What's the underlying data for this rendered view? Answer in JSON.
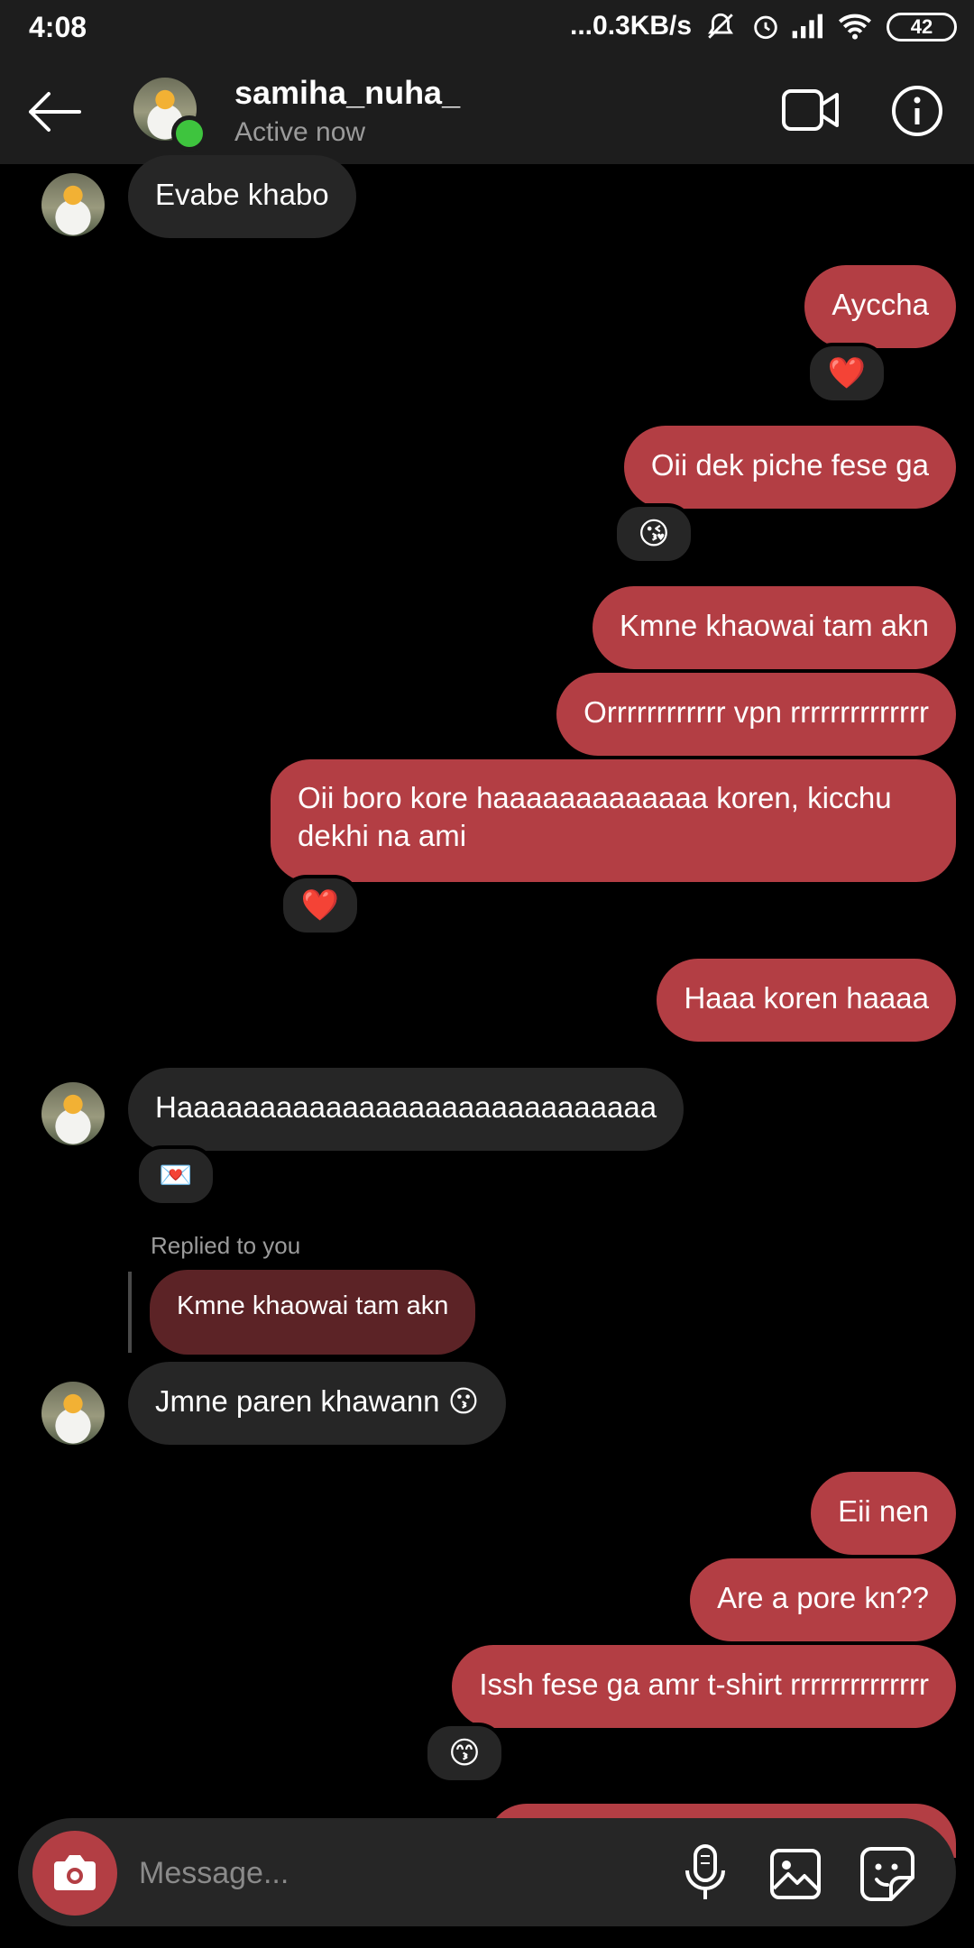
{
  "status_bar": {
    "time": "4:08",
    "network_speed": "...0.3KB/s",
    "battery": "42"
  },
  "header": {
    "username": "samiha_nuha_",
    "status": "Active now"
  },
  "messages": [
    {
      "text": "Evabe khabo"
    },
    {
      "text": "Ayccha",
      "reaction": "❤️"
    },
    {
      "text": "Oii dek piche fese ga",
      "reaction": "😘"
    },
    {
      "text": "Kmne khaowai tam akn"
    },
    {
      "text": "Orrrrrrrrrrrr vpn rrrrrrrrrrrrrr"
    },
    {
      "text": "Oii boro kore haaaaaaaaaaaaa koren, kicchu dekhi na ami",
      "reaction": "❤️"
    },
    {
      "text": "Haaa koren haaaa"
    },
    {
      "text": "Haaaaaaaaaaaaaaaaaaaaaaaaaaaaa",
      "reaction": "💌"
    },
    {
      "replied_label": "Replied to you",
      "quoted": "Kmne khaowai tam akn",
      "text": "Jmne paren khawann 😗"
    },
    {
      "text": "Eii nen"
    },
    {
      "text": "Are a pore kn??"
    },
    {
      "text": "Issh fese ga amr t-shirt rrrrrrrrrrrrrr",
      "reaction": "😙"
    }
  ],
  "composer": {
    "placeholder": "Message..."
  },
  "colors": {
    "outgoing_bubble": "#b33e44",
    "incoming_bubble": "#262626",
    "background": "#000000",
    "header": "#1d1d1d",
    "online_dot": "#3ec43e"
  }
}
